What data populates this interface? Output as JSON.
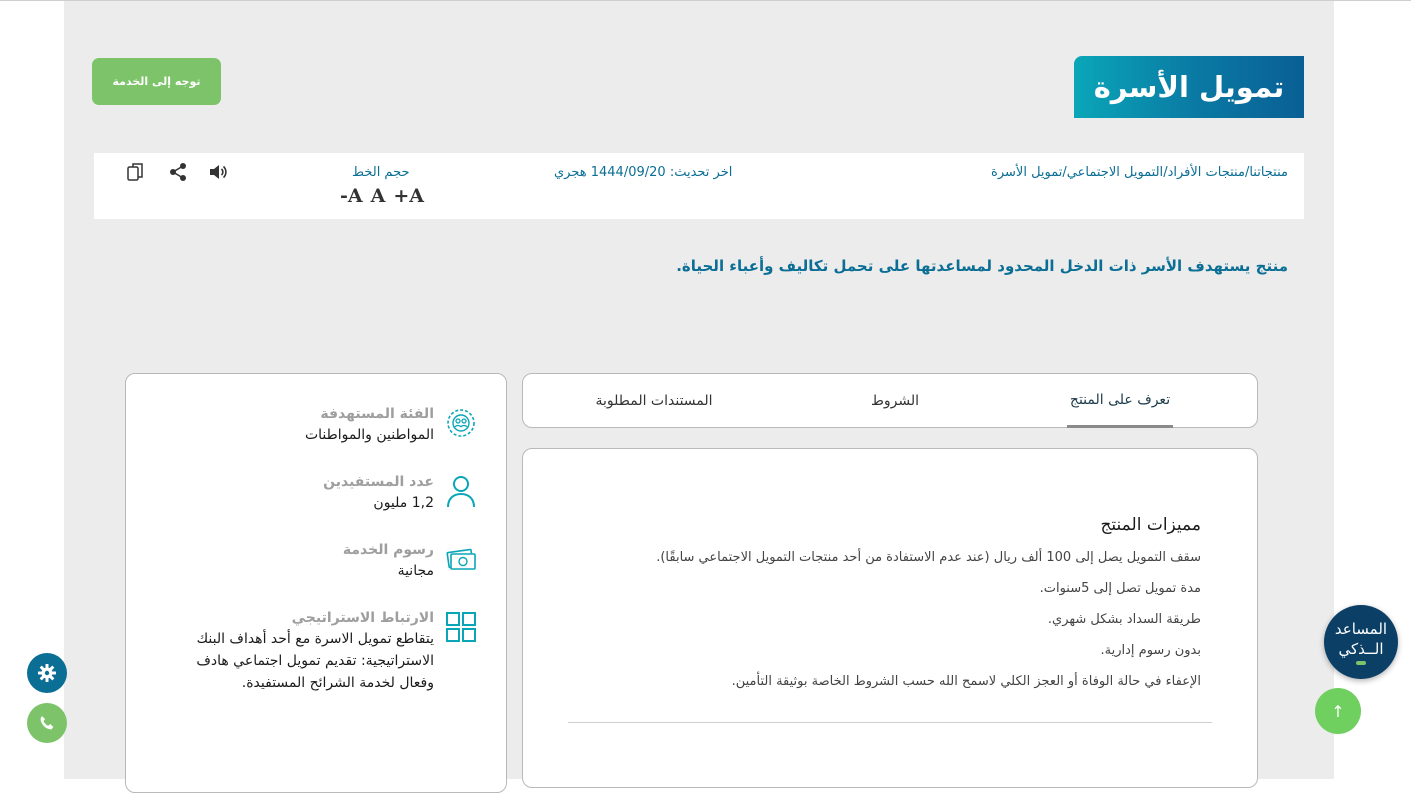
{
  "colors": {
    "accent": "#0b6e94",
    "green": "#7cc36a",
    "navy": "#0b3f66",
    "background": "#ececec"
  },
  "header": {
    "title": "تمويل الأسرة",
    "service_button": "توجه إلى الخدمة"
  },
  "infobar": {
    "breadcrumb": [
      "منتجاتنا",
      "منتجات الأفراد",
      "التمويل الاجتماعي",
      "تمويل الأسرة"
    ],
    "breadcrumb_separator": "/",
    "last_update_label": "اخر تحديث:",
    "last_update_value": "1444/09/20 هجري",
    "font_size_label": "حجم الخط",
    "font_controls": {
      "decrease": "-A",
      "reset": "A",
      "increase": "+A"
    },
    "icons": [
      "copy-icon",
      "share-icon",
      "speaker-icon"
    ]
  },
  "intro": "منتج يستهدف الأسر ذات الدخل المحدود لمساعدتها على تحمل تكاليف وأعباء الحياة.",
  "side_card": {
    "items": [
      {
        "label": "الفئة المستهدفة",
        "value": "المواطنين والمواطنات",
        "icon": "target-group-icon"
      },
      {
        "label": "عدد المستفيدين",
        "value": "1,2 مليون",
        "icon": "person-icon"
      },
      {
        "label": "رسوم الخدمة",
        "value": "مجانية",
        "icon": "money-icon"
      },
      {
        "label": "الارتباط الاستراتيجي",
        "value": "يتقاطع تمويل الاسرة مع أحد أهداف البنك الاستراتيجية: تقديم تمويل اجتماعي هادف وفعال لخدمة الشرائح المستفيدة.",
        "icon": "grid-icon"
      }
    ]
  },
  "tabs": {
    "active": "تعرف على المنتج",
    "items": [
      "تعرف على المنتج",
      "الشروط",
      "المستندات المطلوبة"
    ]
  },
  "content": {
    "title": "مميزات المنتج",
    "features": [
      "سقف التمويل يصل إلى 100 ألف ريال (عند عدم الاستفادة من أحد منتجات التمويل الاجتماعي سابقًا).",
      "مدة تمويل تصل إلى 5سنوات.",
      "طريقة السداد بشكل شهري.",
      "بدون رسوم إدارية.",
      "الإعفاء في حالة الوفاة أو العجز الكلي لاسمح الله حسب الشروط الخاصة بوثيقة التأمين."
    ]
  },
  "floating": {
    "assistant_line1": "المساعد",
    "assistant_line2": "الــذكي",
    "scroll_top": "↑"
  }
}
